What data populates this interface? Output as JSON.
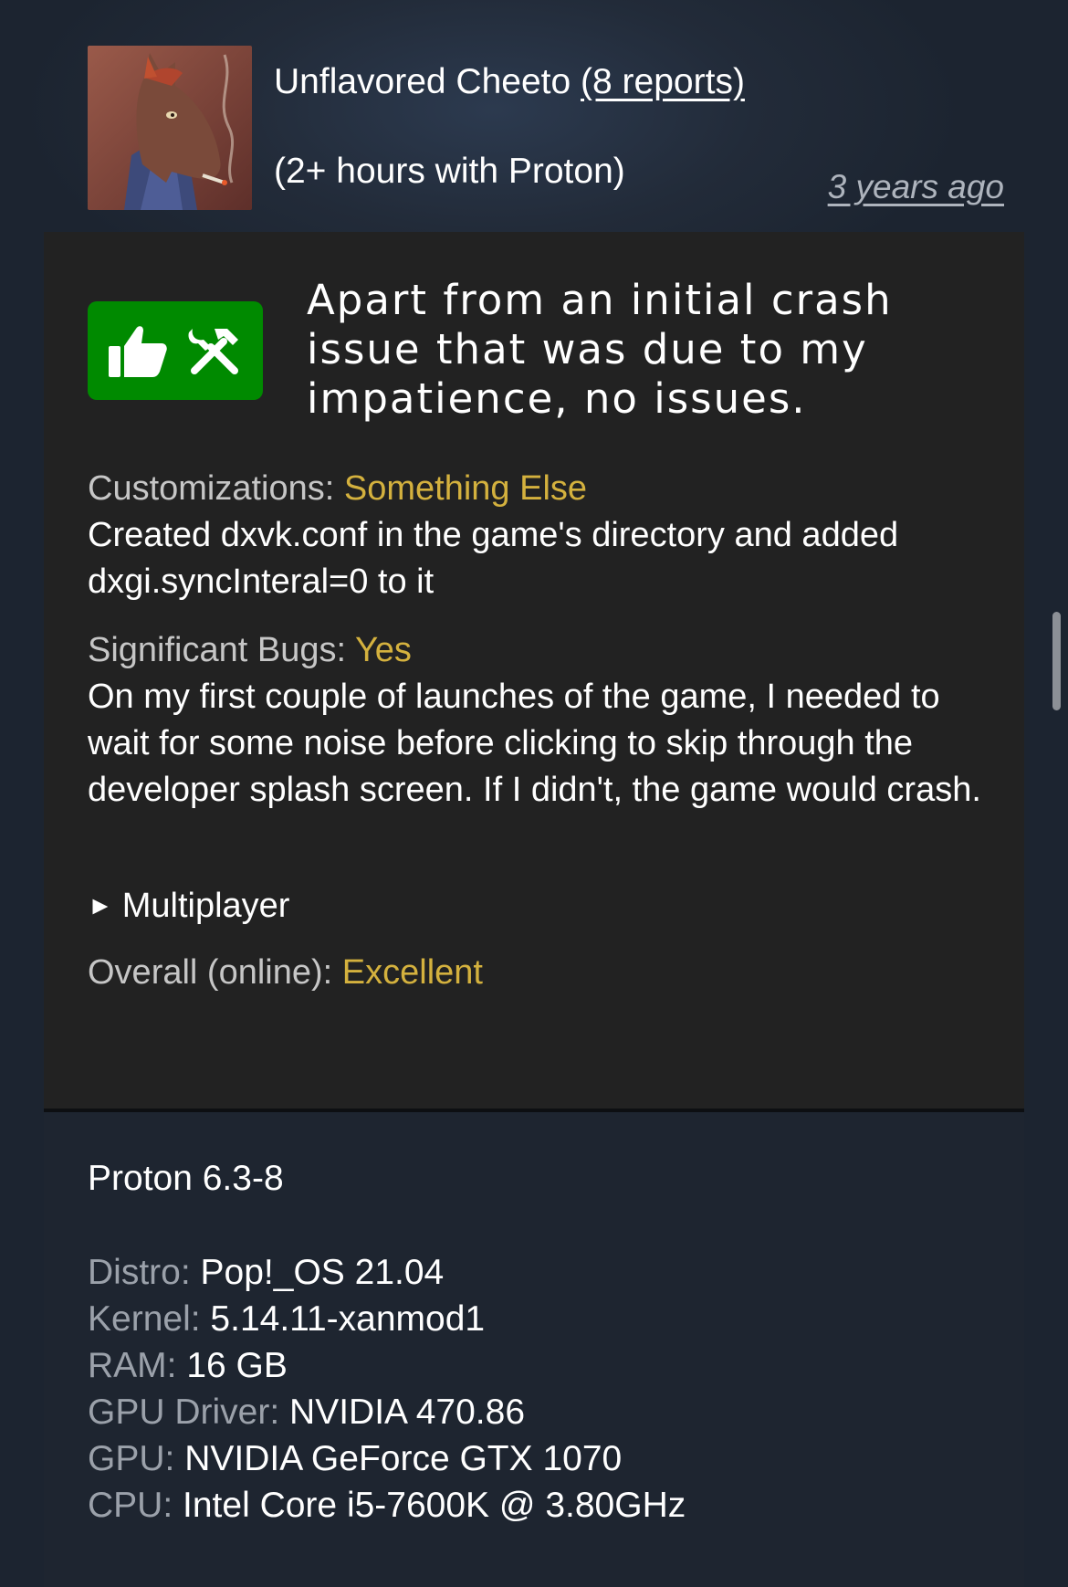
{
  "header": {
    "author": "Unflavored Cheeto",
    "reports_link": "(8 reports)",
    "playtime": "(2+ hours with Proton)",
    "timestamp": "3 years ago",
    "avatar_icon": "horse-avatar-icon"
  },
  "report": {
    "rating_icons": [
      "thumbs-up-icon",
      "tools-icon"
    ],
    "rating_color": "#008a00",
    "summary": "Apart from an initial crash issue that was due to my impatience, no issues.",
    "customizations": {
      "label": "Customizations:",
      "value": "Something Else",
      "details": "Created dxvk.conf in the game's directory and added dxgi.syncInteral=0 to it"
    },
    "bugs": {
      "label": "Significant Bugs:",
      "value": "Yes",
      "details": "On my first couple of launches of the game, I needed to wait for some noise before clicking to skip through the developer splash screen. If I didn't, the game would crash."
    },
    "multiplayer": {
      "toggle_glyph": "►",
      "label": "Multiplayer"
    },
    "overall": {
      "label": "Overall (online):",
      "value": "Excellent"
    },
    "accent_color": "#d4b13e"
  },
  "system": {
    "proton_version": "Proton 6.3-8",
    "specs": [
      {
        "label": "Distro:",
        "value": "Pop!_OS 21.04"
      },
      {
        "label": "Kernel:",
        "value": "5.14.11-xanmod1"
      },
      {
        "label": "RAM:",
        "value": "16 GB"
      },
      {
        "label": "GPU Driver:",
        "value": "NVIDIA 470.86"
      },
      {
        "label": "GPU:",
        "value": "NVIDIA GeForce GTX 1070"
      },
      {
        "label": "CPU:",
        "value": "Intel Core i5-7600K @ 3.80GHz"
      }
    ]
  }
}
